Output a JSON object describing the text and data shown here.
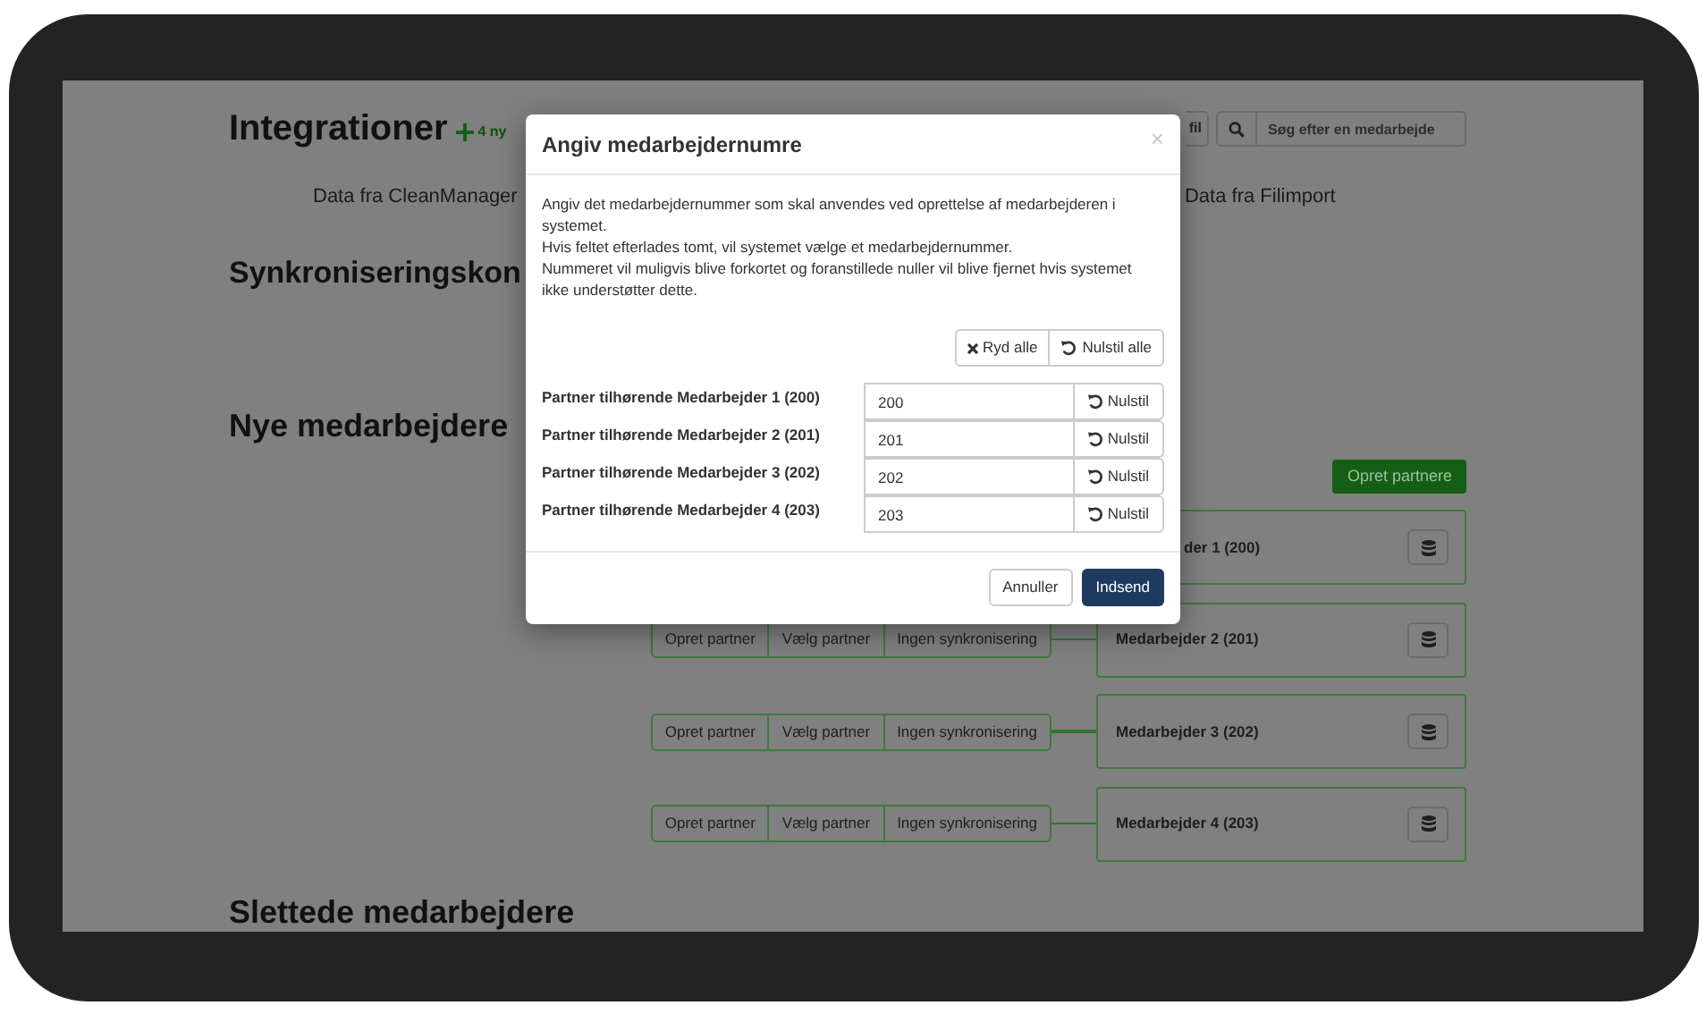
{
  "page": {
    "title": "Integrationer",
    "badge": "4 ny",
    "file_button": "fil",
    "search": {
      "placeholder": "Søg efter en medarbejde"
    },
    "source_tabs": [
      "Data fra CleanManager",
      "Data fra Filimport"
    ],
    "sync_heading": "Synkroniseringskon",
    "new_heading": "Nye medarbejdere",
    "create_button": "Opret partnere",
    "employees": [
      {
        "name": "der 1 (200)"
      },
      {
        "name": "Medarbejder 2 (201)",
        "actions": [
          "Opret partner",
          "Vælg partner",
          "Ingen synkronisering"
        ]
      },
      {
        "name": "Medarbejder 3 (202)",
        "actions": [
          "Opret partner",
          "Vælg partner",
          "Ingen synkronisering"
        ]
      },
      {
        "name": "Medarbejder 4 (203)",
        "actions": [
          "Opret partner",
          "Vælg partner",
          "Ingen synkronisering"
        ]
      }
    ],
    "deleted_heading": "Slettede medarbejdere"
  },
  "modal": {
    "title": "Angiv medarbejdernumre",
    "close": "×",
    "paragraphs": [
      "Angiv det medarbejdernummer som skal anvendes ved oprettelse af medarbejderen i systemet.",
      "Hvis feltet efterlades tomt, vil systemet vælge et medarbejdernummer.",
      "Nummeret vil muligvis blive forkortet og foranstillede nuller vil blive fjernet hvis systemet ikke understøtter dette."
    ],
    "clear_all": "Ryd alle",
    "reset_all": "Nulstil alle",
    "fields": [
      {
        "label": "Partner tilhørende Medarbejder 1 (200)",
        "value": "200",
        "reset": "Nulstil"
      },
      {
        "label": "Partner tilhørende Medarbejder 2 (201)",
        "value": "201",
        "reset": "Nulstil"
      },
      {
        "label": "Partner tilhørende Medarbejder 3 (202)",
        "value": "202",
        "reset": "Nulstil"
      },
      {
        "label": "Partner tilhørende Medarbejder 4 (203)",
        "value": "203",
        "reset": "Nulstil"
      }
    ],
    "cancel": "Annuller",
    "submit": "Indsend"
  }
}
